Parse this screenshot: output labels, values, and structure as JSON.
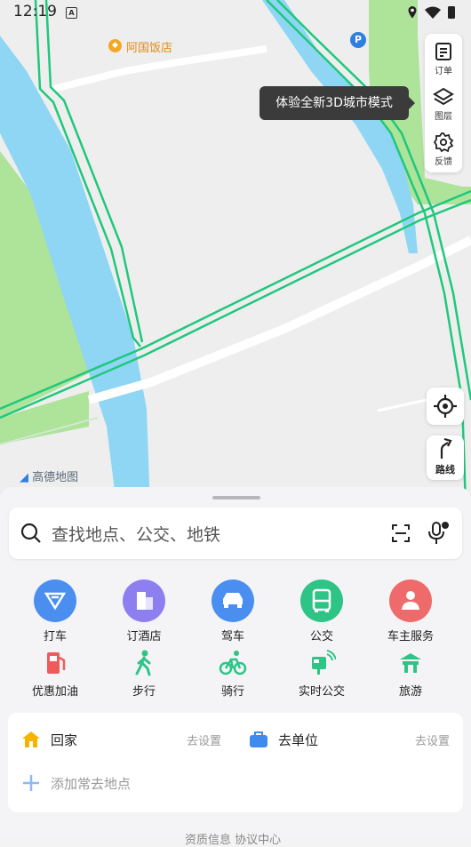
{
  "status_bar": {
    "time": "12:19",
    "notification_badge": "A",
    "icons": [
      "location-icon",
      "wifi-icon",
      "battery-icon"
    ]
  },
  "map": {
    "poi_label": "阿国饭店",
    "parking_label": "P",
    "tooltip": "体验全新3D城市模式",
    "logo_text": "高德地图",
    "colors": {
      "land": "#eeeeee",
      "water": "#8fd6f5",
      "park": "#aee39a",
      "road": "#ffffff",
      "route_line": "#1fc87c"
    }
  },
  "tools": [
    {
      "label": "订单",
      "icon": "order-icon"
    },
    {
      "label": "图层",
      "icon": "layers-icon"
    },
    {
      "label": "反馈",
      "icon": "feedback-gear-icon"
    }
  ],
  "route_button": {
    "label": "路线",
    "icon": "route-arrow-icon"
  },
  "search": {
    "placeholder": "查找地点、公交、地铁",
    "scan_icon": "scan-icon",
    "voice_icon": "mic-icon"
  },
  "services_row1": [
    {
      "label": "打车",
      "color": "#4a8ef0",
      "icon": "taxi-icon"
    },
    {
      "label": "订酒店",
      "color": "#8e7ff0",
      "icon": "hotel-icon"
    },
    {
      "label": "驾车",
      "color": "#4a8ef0",
      "icon": "car-icon"
    },
    {
      "label": "公交",
      "color": "#2ec486",
      "icon": "bus-icon"
    },
    {
      "label": "车主服务",
      "color": "#ef6a6a",
      "icon": "car-owner-icon"
    }
  ],
  "services_row2": [
    {
      "label": "优惠加油",
      "color": "#ef5b5b",
      "icon": "fuel-icon"
    },
    {
      "label": "步行",
      "color": "#2ec486",
      "icon": "walk-icon"
    },
    {
      "label": "骑行",
      "color": "#2ec486",
      "icon": "bike-icon"
    },
    {
      "label": "实时公交",
      "color": "#2ec486",
      "icon": "realtime-bus-icon"
    },
    {
      "label": "旅游",
      "color": "#2ec486",
      "icon": "travel-icon"
    }
  ],
  "places": {
    "home": {
      "label": "回家",
      "action": "去设置"
    },
    "work": {
      "label": "去单位",
      "action": "去设置"
    },
    "add": {
      "label": "添加常去地点"
    }
  },
  "bottom_hint": "资质信息 协议中心"
}
